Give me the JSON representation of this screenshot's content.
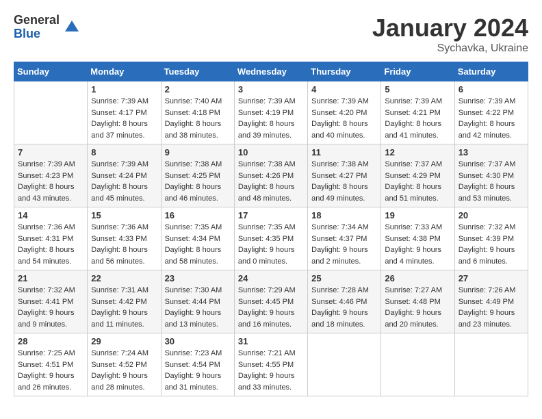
{
  "header": {
    "logo_general": "General",
    "logo_blue": "Blue",
    "month_title": "January 2024",
    "location": "Sychavka, Ukraine"
  },
  "days_of_week": [
    "Sunday",
    "Monday",
    "Tuesday",
    "Wednesday",
    "Thursday",
    "Friday",
    "Saturday"
  ],
  "weeks": [
    [
      {
        "day": "",
        "sunrise": "",
        "sunset": "",
        "daylight": ""
      },
      {
        "day": "1",
        "sunrise": "Sunrise: 7:39 AM",
        "sunset": "Sunset: 4:17 PM",
        "daylight": "Daylight: 8 hours and 37 minutes."
      },
      {
        "day": "2",
        "sunrise": "Sunrise: 7:40 AM",
        "sunset": "Sunset: 4:18 PM",
        "daylight": "Daylight: 8 hours and 38 minutes."
      },
      {
        "day": "3",
        "sunrise": "Sunrise: 7:39 AM",
        "sunset": "Sunset: 4:19 PM",
        "daylight": "Daylight: 8 hours and 39 minutes."
      },
      {
        "day": "4",
        "sunrise": "Sunrise: 7:39 AM",
        "sunset": "Sunset: 4:20 PM",
        "daylight": "Daylight: 8 hours and 40 minutes."
      },
      {
        "day": "5",
        "sunrise": "Sunrise: 7:39 AM",
        "sunset": "Sunset: 4:21 PM",
        "daylight": "Daylight: 8 hours and 41 minutes."
      },
      {
        "day": "6",
        "sunrise": "Sunrise: 7:39 AM",
        "sunset": "Sunset: 4:22 PM",
        "daylight": "Daylight: 8 hours and 42 minutes."
      }
    ],
    [
      {
        "day": "7",
        "sunrise": "Sunrise: 7:39 AM",
        "sunset": "Sunset: 4:23 PM",
        "daylight": "Daylight: 8 hours and 43 minutes."
      },
      {
        "day": "8",
        "sunrise": "Sunrise: 7:39 AM",
        "sunset": "Sunset: 4:24 PM",
        "daylight": "Daylight: 8 hours and 45 minutes."
      },
      {
        "day": "9",
        "sunrise": "Sunrise: 7:38 AM",
        "sunset": "Sunset: 4:25 PM",
        "daylight": "Daylight: 8 hours and 46 minutes."
      },
      {
        "day": "10",
        "sunrise": "Sunrise: 7:38 AM",
        "sunset": "Sunset: 4:26 PM",
        "daylight": "Daylight: 8 hours and 48 minutes."
      },
      {
        "day": "11",
        "sunrise": "Sunrise: 7:38 AM",
        "sunset": "Sunset: 4:27 PM",
        "daylight": "Daylight: 8 hours and 49 minutes."
      },
      {
        "day": "12",
        "sunrise": "Sunrise: 7:37 AM",
        "sunset": "Sunset: 4:29 PM",
        "daylight": "Daylight: 8 hours and 51 minutes."
      },
      {
        "day": "13",
        "sunrise": "Sunrise: 7:37 AM",
        "sunset": "Sunset: 4:30 PM",
        "daylight": "Daylight: 8 hours and 53 minutes."
      }
    ],
    [
      {
        "day": "14",
        "sunrise": "Sunrise: 7:36 AM",
        "sunset": "Sunset: 4:31 PM",
        "daylight": "Daylight: 8 hours and 54 minutes."
      },
      {
        "day": "15",
        "sunrise": "Sunrise: 7:36 AM",
        "sunset": "Sunset: 4:33 PM",
        "daylight": "Daylight: 8 hours and 56 minutes."
      },
      {
        "day": "16",
        "sunrise": "Sunrise: 7:35 AM",
        "sunset": "Sunset: 4:34 PM",
        "daylight": "Daylight: 8 hours and 58 minutes."
      },
      {
        "day": "17",
        "sunrise": "Sunrise: 7:35 AM",
        "sunset": "Sunset: 4:35 PM",
        "daylight": "Daylight: 9 hours and 0 minutes."
      },
      {
        "day": "18",
        "sunrise": "Sunrise: 7:34 AM",
        "sunset": "Sunset: 4:37 PM",
        "daylight": "Daylight: 9 hours and 2 minutes."
      },
      {
        "day": "19",
        "sunrise": "Sunrise: 7:33 AM",
        "sunset": "Sunset: 4:38 PM",
        "daylight": "Daylight: 9 hours and 4 minutes."
      },
      {
        "day": "20",
        "sunrise": "Sunrise: 7:32 AM",
        "sunset": "Sunset: 4:39 PM",
        "daylight": "Daylight: 9 hours and 6 minutes."
      }
    ],
    [
      {
        "day": "21",
        "sunrise": "Sunrise: 7:32 AM",
        "sunset": "Sunset: 4:41 PM",
        "daylight": "Daylight: 9 hours and 9 minutes."
      },
      {
        "day": "22",
        "sunrise": "Sunrise: 7:31 AM",
        "sunset": "Sunset: 4:42 PM",
        "daylight": "Daylight: 9 hours and 11 minutes."
      },
      {
        "day": "23",
        "sunrise": "Sunrise: 7:30 AM",
        "sunset": "Sunset: 4:44 PM",
        "daylight": "Daylight: 9 hours and 13 minutes."
      },
      {
        "day": "24",
        "sunrise": "Sunrise: 7:29 AM",
        "sunset": "Sunset: 4:45 PM",
        "daylight": "Daylight: 9 hours and 16 minutes."
      },
      {
        "day": "25",
        "sunrise": "Sunrise: 7:28 AM",
        "sunset": "Sunset: 4:46 PM",
        "daylight": "Daylight: 9 hours and 18 minutes."
      },
      {
        "day": "26",
        "sunrise": "Sunrise: 7:27 AM",
        "sunset": "Sunset: 4:48 PM",
        "daylight": "Daylight: 9 hours and 20 minutes."
      },
      {
        "day": "27",
        "sunrise": "Sunrise: 7:26 AM",
        "sunset": "Sunset: 4:49 PM",
        "daylight": "Daylight: 9 hours and 23 minutes."
      }
    ],
    [
      {
        "day": "28",
        "sunrise": "Sunrise: 7:25 AM",
        "sunset": "Sunset: 4:51 PM",
        "daylight": "Daylight: 9 hours and 26 minutes."
      },
      {
        "day": "29",
        "sunrise": "Sunrise: 7:24 AM",
        "sunset": "Sunset: 4:52 PM",
        "daylight": "Daylight: 9 hours and 28 minutes."
      },
      {
        "day": "30",
        "sunrise": "Sunrise: 7:23 AM",
        "sunset": "Sunset: 4:54 PM",
        "daylight": "Daylight: 9 hours and 31 minutes."
      },
      {
        "day": "31",
        "sunrise": "Sunrise: 7:21 AM",
        "sunset": "Sunset: 4:55 PM",
        "daylight": "Daylight: 9 hours and 33 minutes."
      },
      {
        "day": "",
        "sunrise": "",
        "sunset": "",
        "daylight": ""
      },
      {
        "day": "",
        "sunrise": "",
        "sunset": "",
        "daylight": ""
      },
      {
        "day": "",
        "sunrise": "",
        "sunset": "",
        "daylight": ""
      }
    ]
  ]
}
